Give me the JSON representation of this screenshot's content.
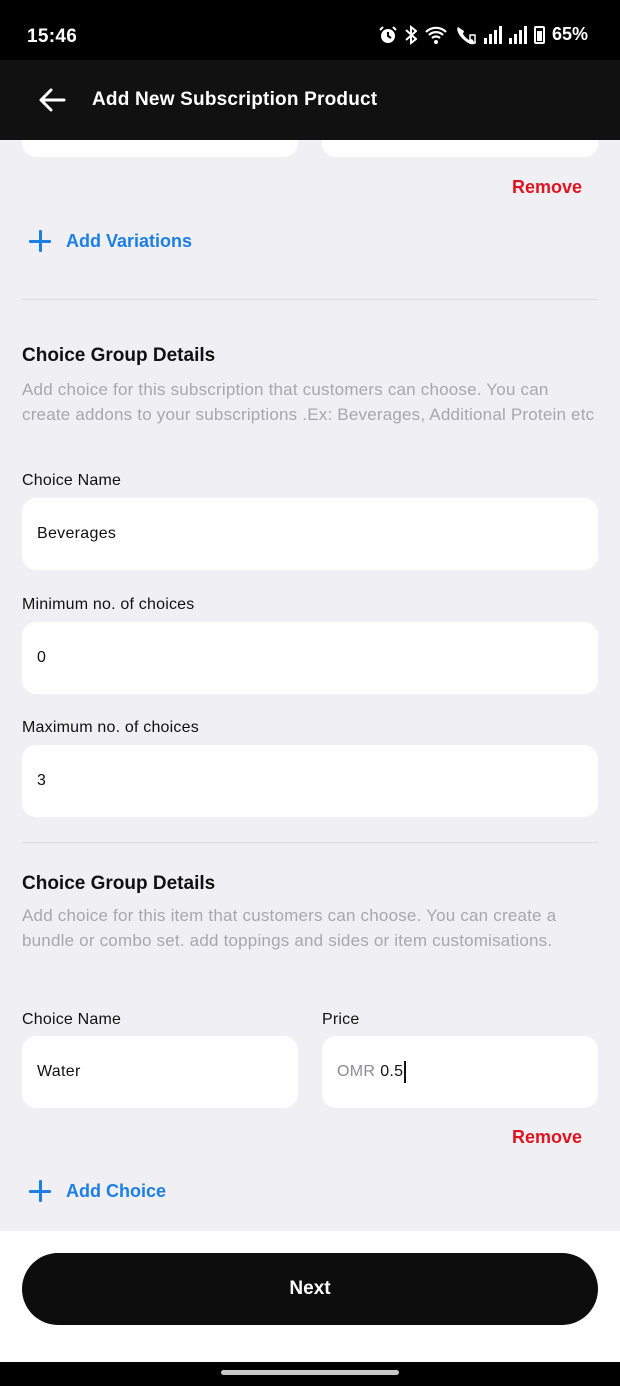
{
  "status_bar": {
    "time": "15:46",
    "battery": "65%",
    "icons": [
      "alarm-icon",
      "bluetooth-icon",
      "wifi-icon",
      "wifi-calling-icon",
      "signal-icon",
      "signal-icon",
      "battery-icon"
    ]
  },
  "app_bar": {
    "title": "Add New Subscription Product",
    "back_icon": "arrow-left-icon"
  },
  "variations": {
    "remove_label": "Remove",
    "add_label": "Add Variations"
  },
  "choice_group_1": {
    "heading": "Choice Group Details",
    "help_text": "Add choice for this subscription that customers can choose. You can create addons to your subscriptions .Ex:  Beverages, Additional Protein etc",
    "choice_name_label": "Choice Name",
    "choice_name_value": "Beverages",
    "min_label": "Minimum no. of choices",
    "min_value": "0",
    "max_label": "Maximum no. of choices",
    "max_value": "3"
  },
  "choice_group_2": {
    "heading": "Choice Group Details",
    "help_text": "Add choice for this item that customers can choose. You can create a bundle or combo set. add toppings and sides or item customisations.",
    "choice_name_label": "Choice Name",
    "choice_name_value": "Water",
    "price_label": "Price",
    "price_prefix": "OMR",
    "price_value": "0.5",
    "remove_label": "Remove",
    "add_choice_label": "Add Choice"
  },
  "footer": {
    "next_label": "Next"
  },
  "colors": {
    "accent_blue": "#1c7fe6",
    "remove_red": "#e0141e",
    "background": "#f0eff4",
    "button_black": "#0d0d0d"
  }
}
